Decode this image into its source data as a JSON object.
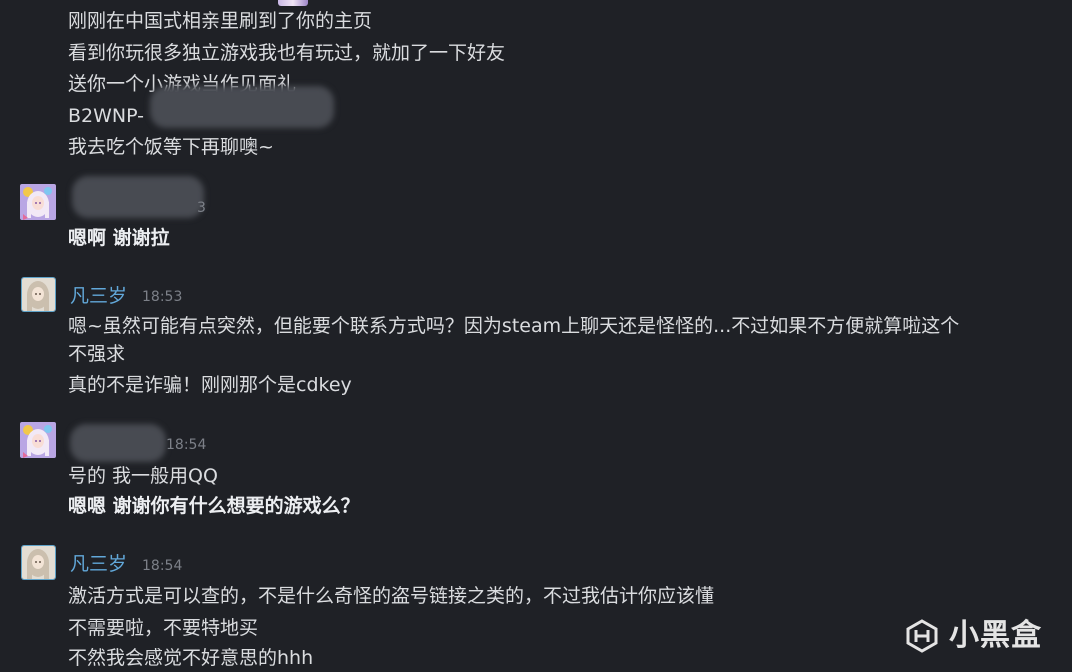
{
  "messages": {
    "m1": {
      "line1": "刚刚在中国式相亲里刷到了你的主页",
      "line2": "看到你玩很多独立游戏我也有玩过，就加了一下好友",
      "line3": "送你一个小游戏当作见面礼",
      "line4": "B2WNP-",
      "line5": "我去吃个饭等下再聊噢~"
    },
    "g2": {
      "time_fragment": "3",
      "line1": "嗯啊 谢谢拉"
    },
    "g3": {
      "name": "凡三岁",
      "time": "18:53",
      "line1": "嗯~虽然可能有点突然，但能要个联系方式吗？因为steam上聊天还是怪怪的...不过如果不方便就算啦这个",
      "line2": "不强求",
      "line3": "真的不是诈骗！刚刚那个是cdkey"
    },
    "g4": {
      "time": "18:54",
      "line1": "号的 我一般用QQ",
      "line2": "嗯嗯 谢谢你有什么想要的游戏么？"
    },
    "g5": {
      "name": "凡三岁",
      "time": "18:54",
      "line1": "激活方式是可以查的，不是什么奇怪的盗号链接之类的，不过我估计你应该懂",
      "line2": "不需要啦，不要特地买",
      "line3": "不然我会感觉不好意思的hhh"
    }
  },
  "watermark": {
    "text": "小黑盒",
    "icon": "xiaoheihe-logo-icon"
  },
  "colors": {
    "background": "#1f2126",
    "name": "#62a8d9",
    "text": "#dadcdf",
    "timestamp": "#7c8088"
  }
}
